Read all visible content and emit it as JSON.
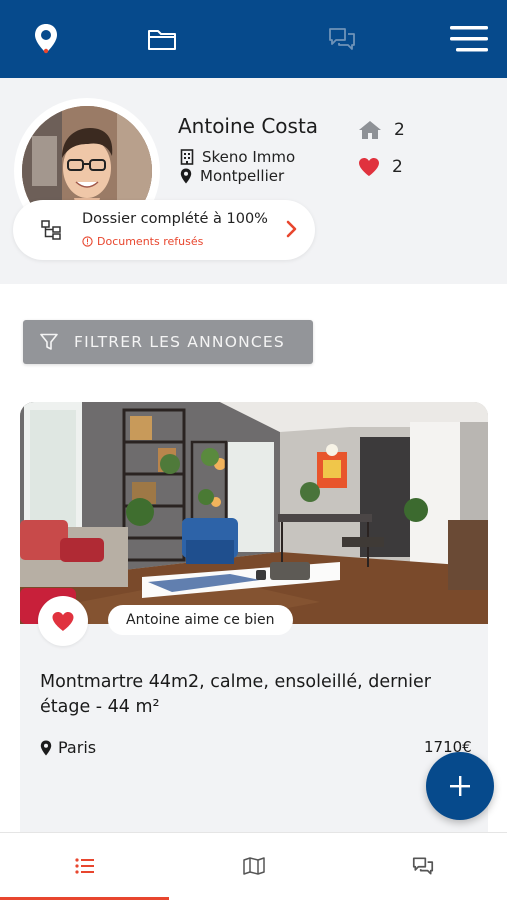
{
  "colors": {
    "primary": "#064a8c",
    "accent": "#e8462e",
    "filter_bg": "#939599",
    "heart": "#e0323e"
  },
  "topbar": {
    "icons": [
      "location-pin-icon",
      "folder-icon",
      "chat-icon",
      "menu-icon"
    ]
  },
  "profile": {
    "name": "Antoine Costa",
    "agency": "Skeno Immo",
    "city": "Montpellier",
    "homes_count": "2",
    "likes_count": "2",
    "dossier_title": "Dossier complété à 100%",
    "dossier_warning": "Documents refusés"
  },
  "filter": {
    "label": "FILTRER LES ANNONCES"
  },
  "listing": {
    "like_label": "Antoine aime ce bien",
    "title": "Montmartre 44m2, calme, ensoleillé, dernier étage - 44 m²",
    "city": "Paris",
    "price": "1710€"
  },
  "bottom_nav": {
    "tabs": [
      "list-icon",
      "map-icon",
      "chat-icon"
    ],
    "active": 0
  }
}
